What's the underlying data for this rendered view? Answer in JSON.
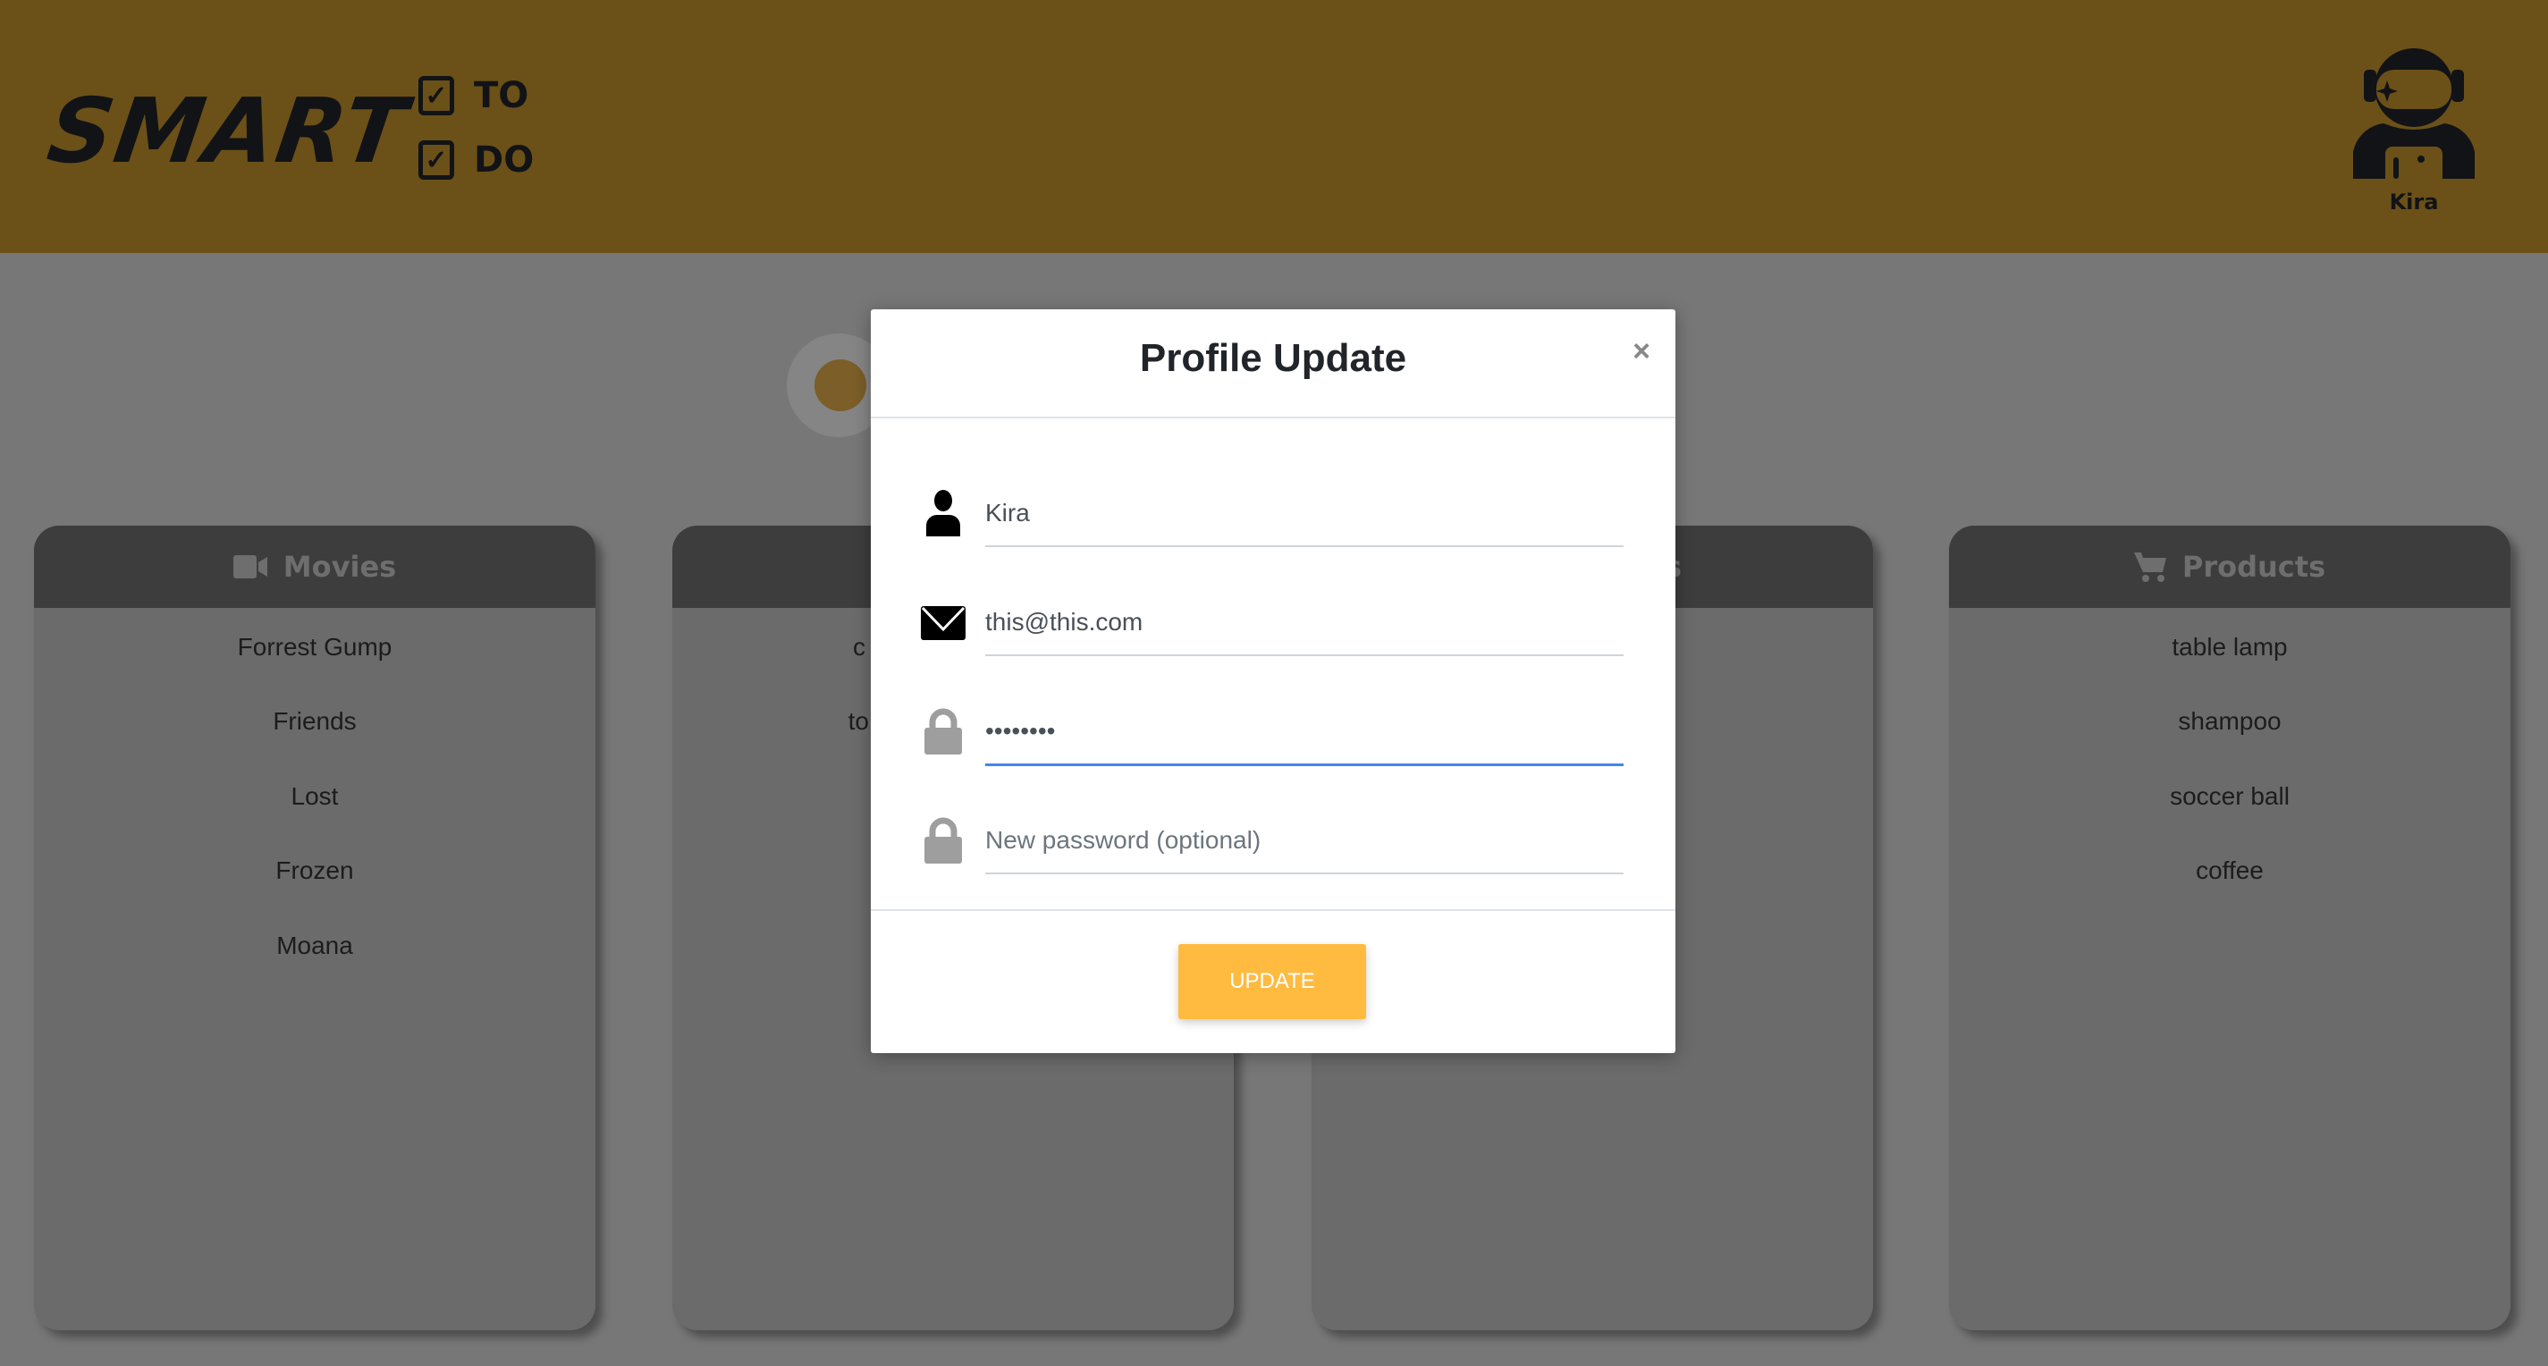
{
  "header": {
    "logo_text": "SMART",
    "todo_words": [
      "TO",
      "DO"
    ],
    "user_name": "Kira"
  },
  "cards": [
    {
      "title": "Movies",
      "icon": "video-camera-icon",
      "items": [
        "Forrest Gump",
        "Friends",
        "Lost",
        "Frozen",
        "Moana"
      ]
    },
    {
      "title": "",
      "icon": "",
      "items": [
        "c",
        "to"
      ]
    },
    {
      "title": "s",
      "icon": "",
      "items": []
    },
    {
      "title": "Products",
      "icon": "shopping-cart-icon",
      "items": [
        "table lamp",
        "shampoo",
        "soccer ball",
        "coffee"
      ]
    }
  ],
  "modal": {
    "title": "Profile Update",
    "close": "×",
    "name_value": "Kira",
    "email_value": "this@this.com",
    "password_value": "••••••••",
    "new_password_placeholder": "New password (optional)",
    "update_label": "UPDATE"
  },
  "colors": {
    "header": "#6b5018",
    "accent": "#ffbb40",
    "focus": "#4285f4"
  }
}
